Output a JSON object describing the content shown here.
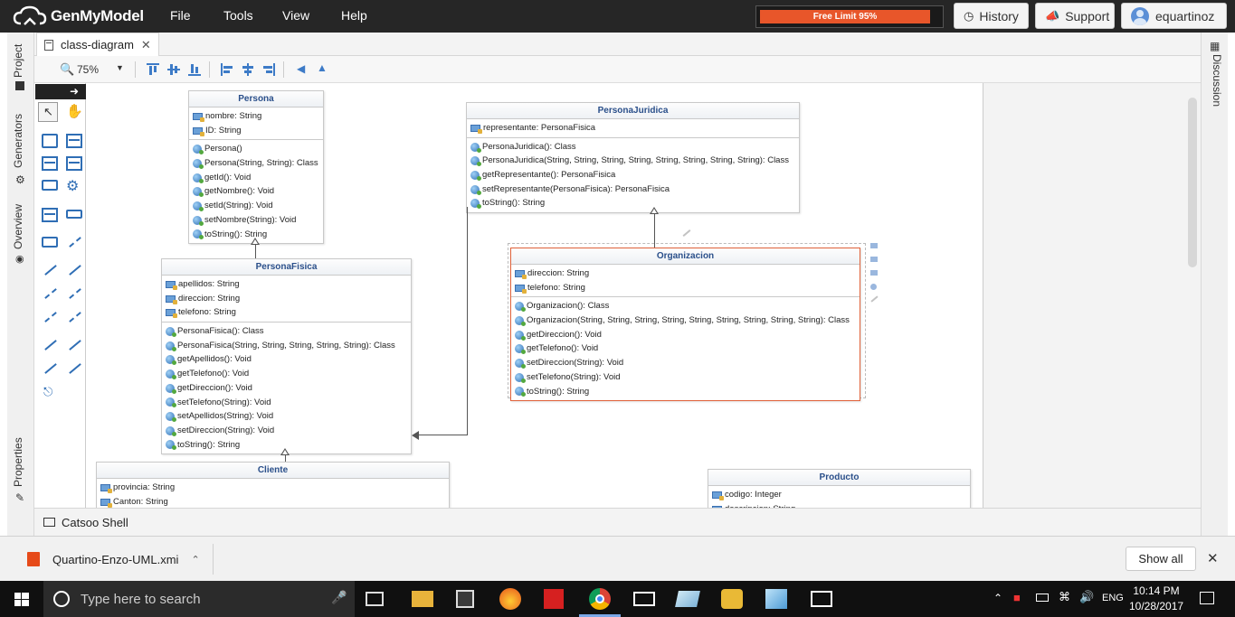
{
  "app": {
    "brand": "GenMyModel",
    "menu": [
      "File",
      "Tools",
      "View",
      "Help"
    ],
    "free_limit": "Free Limit 95%",
    "free_limit_fraction": 0.95,
    "history_label": "History",
    "support_label": "Support",
    "user_name": "equartinoz"
  },
  "side_tabs": {
    "project": "Project",
    "generators": "Generators",
    "overview": "Overview",
    "properties": "Properties",
    "discussion": "Discussion"
  },
  "editor": {
    "tab_label": "class-diagram",
    "zoom": "75%",
    "shell_label": "Catsoo Shell"
  },
  "diagram": {
    "classes": {
      "persona": {
        "name": "Persona",
        "attributes": [
          "nombre: String",
          "ID: String"
        ],
        "operations": [
          "Persona()",
          "Persona(String, String): Class",
          "getId(): Void",
          "getNombre(): Void",
          "setId(String): Void",
          "setNombre(String): Void",
          "toString(): String"
        ]
      },
      "persona_juridica": {
        "name": "PersonaJuridica",
        "attributes": [
          "representante: PersonaFisica"
        ],
        "operations": [
          "PersonaJuridica(): Class",
          "PersonaJuridica(String, String, String, String, String, String, String, String): Class",
          "getRepresentante(): PersonaFisica",
          "setRepresentante(PersonaFisica): PersonaFisica",
          "toString(): String"
        ]
      },
      "persona_fisica": {
        "name": "PersonaFisica",
        "attributes": [
          "apellidos: String",
          "direccion: String",
          "telefono: String"
        ],
        "operations": [
          "PersonaFisica(): Class",
          "PersonaFisica(String, String, String, String, String): Class",
          "getApellidos(): Void",
          "getTelefono(): Void",
          "getDireccion(): Void",
          "setTelefono(String): Void",
          "setApellidos(String): Void",
          "setDireccion(String): Void",
          "toString(): String"
        ]
      },
      "organizacion": {
        "name": "Organizacion",
        "attributes": [
          "direccion: String",
          "telefono: String"
        ],
        "operations": [
          "Organizacion(): Class",
          "Organizacion(String, String, String, String, String, String, String, String, String): Class",
          "getDireccion(): Void",
          "getTelefono(): Void",
          "setDireccion(String): Void",
          "setTelefono(String): Void",
          "toString(): String"
        ]
      },
      "cliente": {
        "name": "Cliente",
        "attributes": [
          "provincia: String",
          "Canton: String"
        ],
        "operations": []
      },
      "producto": {
        "name": "Producto",
        "attributes": [
          "codigo: Integer",
          "descripcion: String"
        ],
        "operations": []
      }
    }
  },
  "download": {
    "file_name": "Quartino-Enzo-UML.xmi",
    "show_all": "Show all"
  },
  "taskbar": {
    "search_placeholder": "Type here to search",
    "language": "ENG",
    "time": "10:14 PM",
    "date": "10/28/2017"
  },
  "colors": {
    "accent_blue": "#2f6eb5",
    "class_title": "#2a4f8a",
    "free_limit_bar": "#e8562a",
    "selection": "#e0623a"
  }
}
